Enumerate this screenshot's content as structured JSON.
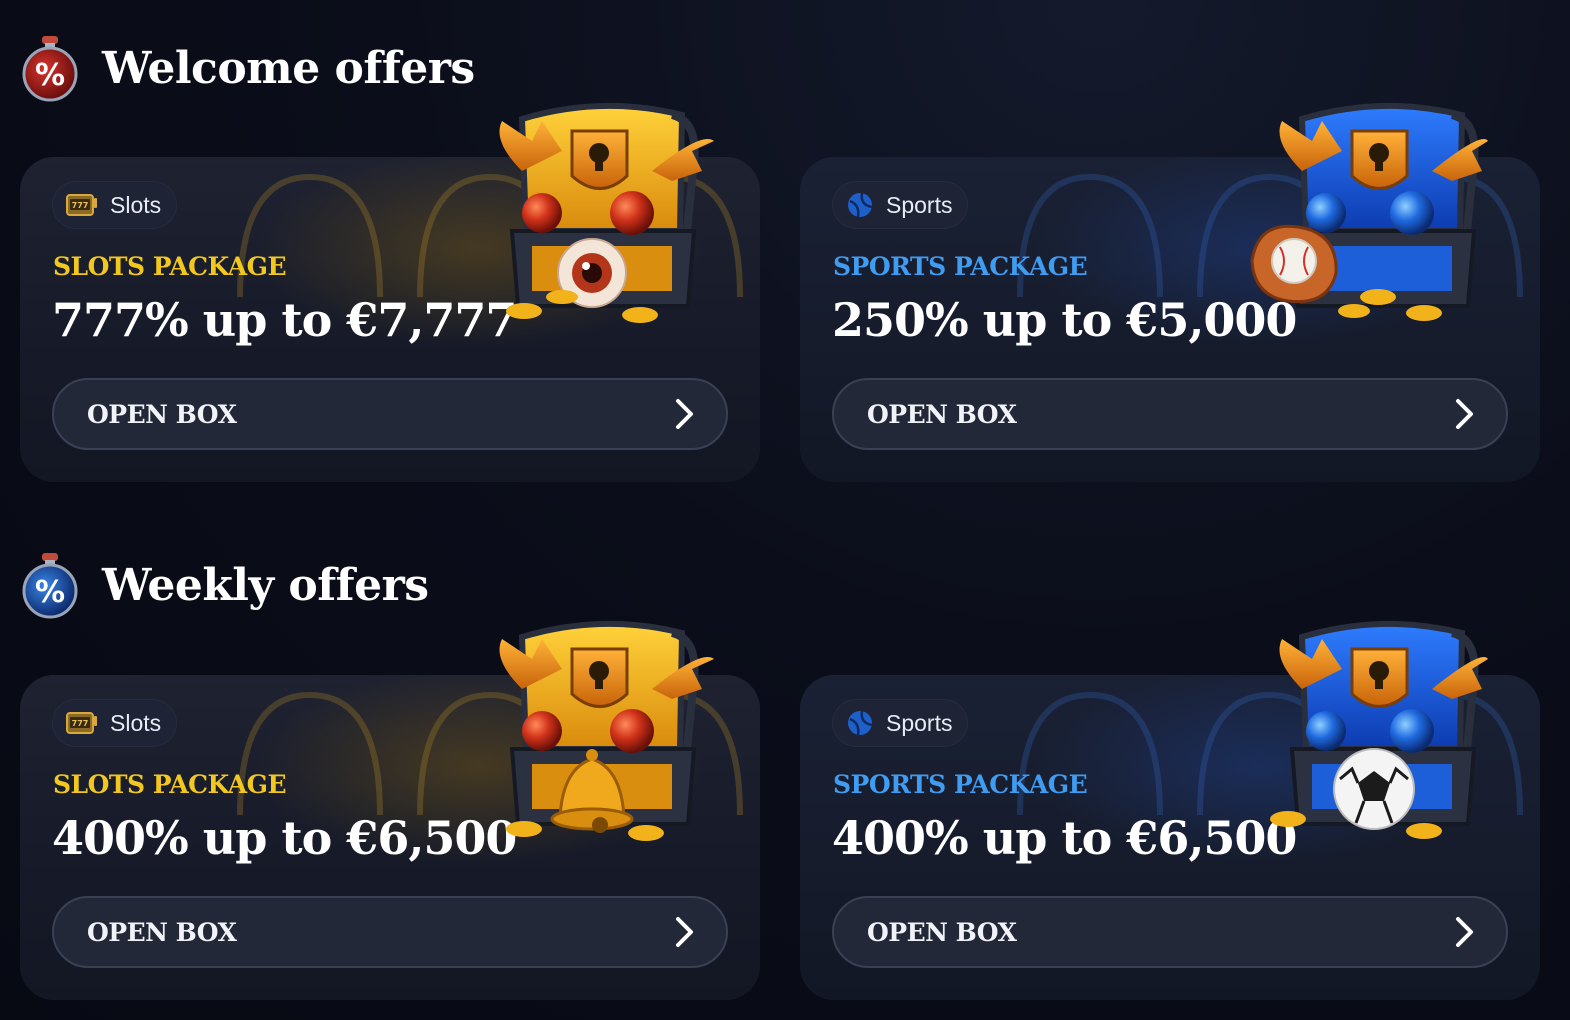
{
  "sections": [
    {
      "title": "Welcome offers",
      "icon": "percent-potion-red-icon",
      "cards": [
        {
          "chip": "Slots",
          "chip_icon": "slot-machine-icon",
          "package": "SLOTS PACKAGE",
          "amount": "777% up to €7,777",
          "button": "OPEN BOX",
          "theme": "gold",
          "chest_item": "eyeball"
        },
        {
          "chip": "Sports",
          "chip_icon": "sports-ball-icon",
          "package": "SPORTS PACKAGE",
          "amount": "250% up to €5,000",
          "button": "OPEN BOX",
          "theme": "blue",
          "chest_item": "baseball-glove"
        }
      ]
    },
    {
      "title": "Weekly offers",
      "icon": "percent-potion-blue-icon",
      "cards": [
        {
          "chip": "Slots",
          "chip_icon": "slot-machine-icon",
          "package": "SLOTS PACKAGE",
          "amount": "400% up to €6,500",
          "button": "OPEN BOX",
          "theme": "gold",
          "chest_item": "bell"
        },
        {
          "chip": "Sports",
          "chip_icon": "sports-ball-icon",
          "package": "SPORTS PACKAGE",
          "amount": "400% up to €6,500",
          "button": "OPEN BOX",
          "theme": "blue",
          "chest_item": "soccer-ball"
        }
      ]
    }
  ],
  "colors": {
    "gold_accent": "#f2c81f",
    "blue_accent": "#3f9cf0",
    "background": "#0b0e1a"
  }
}
